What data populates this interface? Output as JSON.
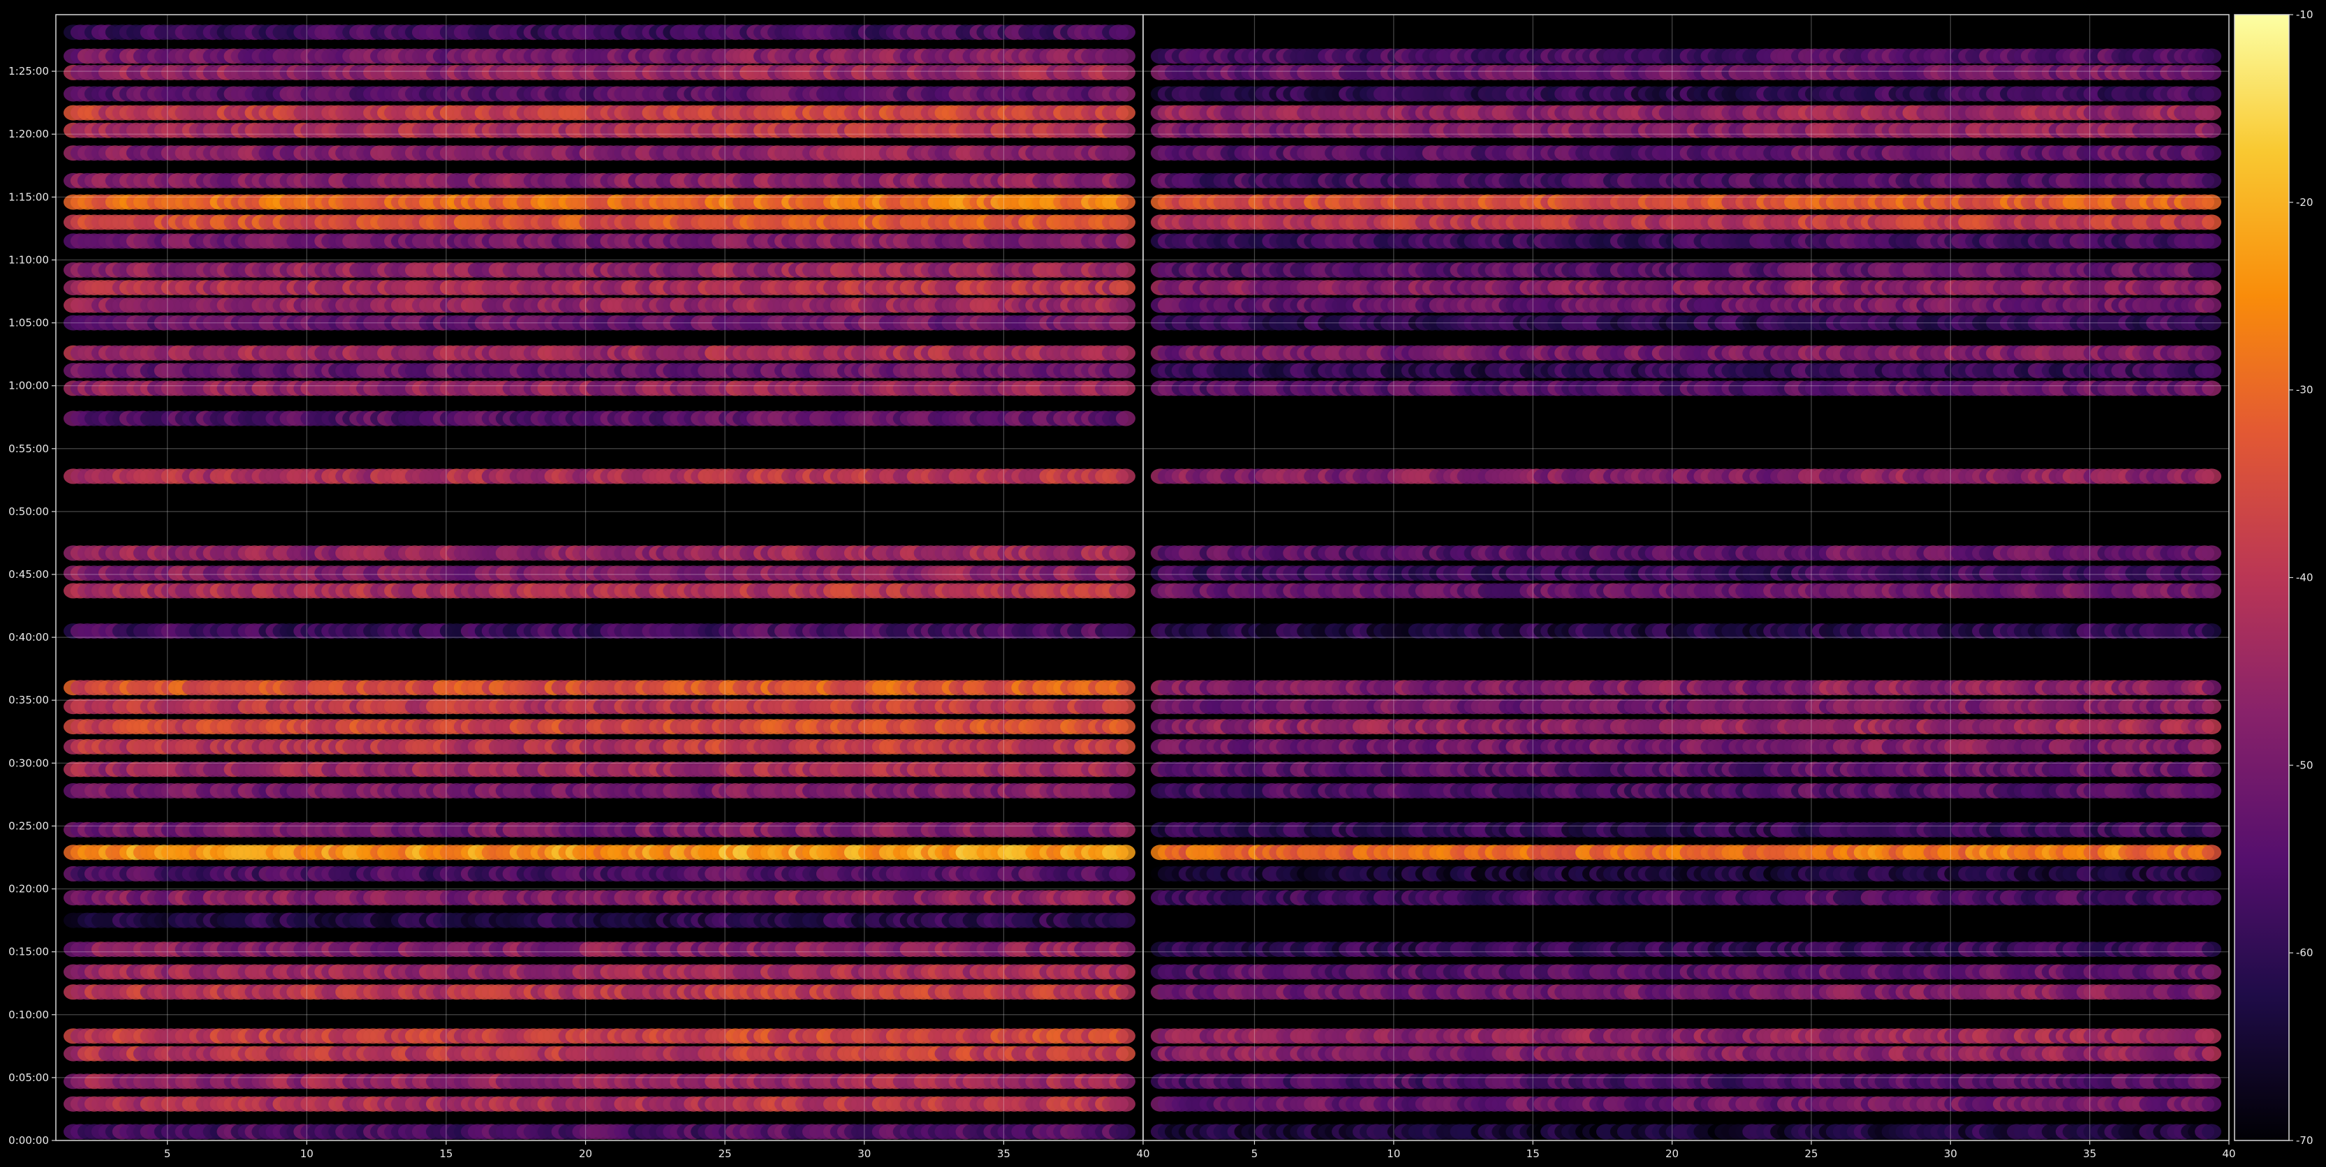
{
  "chart_data": {
    "type": "heatmap",
    "title": "",
    "xlabel": "",
    "ylabel": "",
    "background": "#000000",
    "colormap": "inferno",
    "grid": true,
    "panels": [
      {
        "name": "",
        "xlim": [
          1,
          40
        ],
        "xticks": [
          5,
          10,
          15,
          20,
          25,
          30,
          35,
          40
        ],
        "xtick_labels": [
          "5",
          "10",
          "15",
          "20",
          "25",
          "30",
          "35",
          "40"
        ],
        "channels": [
          2,
          39
        ]
      },
      {
        "name": "",
        "xlim": [
          1,
          40
        ],
        "xticks": [
          5,
          10,
          15,
          20,
          25,
          30,
          35,
          40
        ],
        "xtick_labels": [
          "5",
          "10",
          "15",
          "20",
          "25",
          "30",
          "35",
          "40"
        ],
        "channels": [
          2,
          39
        ]
      }
    ],
    "y_axis": {
      "unit": "minutes",
      "ylim": [
        0,
        89.5
      ],
      "ticks": [
        0,
        5,
        10,
        15,
        20,
        25,
        30,
        35,
        40,
        45,
        50,
        55,
        60,
        65,
        70,
        75,
        80,
        85
      ],
      "tick_labels": [
        "0:00:00",
        "0:05:00",
        "0:10:00",
        "0:15:00",
        "0:20:00",
        "0:25:00",
        "0:30:00",
        "0:35:00",
        "0:40:00",
        "0:45:00",
        "0:50:00",
        "0:55:00",
        "1:00:00",
        "1:05:00",
        "1:10:00",
        "1:15:00",
        "1:20:00",
        "1:25:00"
      ]
    },
    "colorbar": {
      "range": [
        -70,
        -10
      ],
      "ticks": [
        -70,
        -60,
        -50,
        -40,
        -30,
        -20,
        -10
      ],
      "tick_labels": [
        "-70",
        "-60",
        "-50",
        "-40",
        "-30",
        "-20",
        "-10"
      ]
    },
    "bands_left": [
      {
        "t": 0.7,
        "lvl": -56
      },
      {
        "t": 2.9,
        "lvl": -42
      },
      {
        "t": 4.7,
        "lvl": -45
      },
      {
        "t": 6.9,
        "lvl": -40
      },
      {
        "t": 8.3,
        "lvl": -38
      },
      {
        "t": 11.8,
        "lvl": -40
      },
      {
        "t": 13.4,
        "lvl": -44
      },
      {
        "t": 15.2,
        "lvl": -48
      },
      {
        "t": 17.5,
        "lvl": -62
      },
      {
        "t": 19.3,
        "lvl": -48
      },
      {
        "t": 21.2,
        "lvl": -56
      },
      {
        "t": 22.9,
        "lvl": -24
      },
      {
        "t": 24.7,
        "lvl": -50
      },
      {
        "t": 27.8,
        "lvl": -50
      },
      {
        "t": 29.5,
        "lvl": -44
      },
      {
        "t": 31.3,
        "lvl": -40
      },
      {
        "t": 32.9,
        "lvl": -36
      },
      {
        "t": 34.5,
        "lvl": -40
      },
      {
        "t": 36.0,
        "lvl": -34
      },
      {
        "t": 40.5,
        "lvl": -58
      },
      {
        "t": 43.7,
        "lvl": -42
      },
      {
        "t": 45.1,
        "lvl": -48
      },
      {
        "t": 46.7,
        "lvl": -46
      },
      {
        "t": 52.8,
        "lvl": -42
      },
      {
        "t": 57.4,
        "lvl": -54
      },
      {
        "t": 59.8,
        "lvl": -46
      },
      {
        "t": 61.2,
        "lvl": -52
      },
      {
        "t": 62.6,
        "lvl": -44
      },
      {
        "t": 65.0,
        "lvl": -52
      },
      {
        "t": 66.4,
        "lvl": -46
      },
      {
        "t": 67.8,
        "lvl": -42
      },
      {
        "t": 69.2,
        "lvl": -46
      },
      {
        "t": 71.5,
        "lvl": -50
      },
      {
        "t": 73.0,
        "lvl": -34
      },
      {
        "t": 74.6,
        "lvl": -30
      },
      {
        "t": 76.3,
        "lvl": -48
      },
      {
        "t": 78.5,
        "lvl": -48
      },
      {
        "t": 80.3,
        "lvl": -42
      },
      {
        "t": 81.7,
        "lvl": -38
      },
      {
        "t": 83.2,
        "lvl": -54
      },
      {
        "t": 84.9,
        "lvl": -46
      },
      {
        "t": 86.2,
        "lvl": -50
      },
      {
        "t": 88.1,
        "lvl": -58
      }
    ],
    "bands_right": [
      {
        "t": 0.7,
        "lvl": -64
      },
      {
        "t": 2.9,
        "lvl": -52
      },
      {
        "t": 4.7,
        "lvl": -56
      },
      {
        "t": 6.9,
        "lvl": -48
      },
      {
        "t": 8.3,
        "lvl": -46
      },
      {
        "t": 11.8,
        "lvl": -50
      },
      {
        "t": 13.4,
        "lvl": -54
      },
      {
        "t": 15.2,
        "lvl": -60
      },
      {
        "t": 19.3,
        "lvl": -58
      },
      {
        "t": 21.2,
        "lvl": -64
      },
      {
        "t": 22.9,
        "lvl": -30
      },
      {
        "t": 24.7,
        "lvl": -60
      },
      {
        "t": 27.8,
        "lvl": -56
      },
      {
        "t": 29.5,
        "lvl": -54
      },
      {
        "t": 31.3,
        "lvl": -50
      },
      {
        "t": 32.9,
        "lvl": -46
      },
      {
        "t": 34.5,
        "lvl": -50
      },
      {
        "t": 36.0,
        "lvl": -48
      },
      {
        "t": 40.5,
        "lvl": -62
      },
      {
        "t": 43.7,
        "lvl": -52
      },
      {
        "t": 45.1,
        "lvl": -58
      },
      {
        "t": 46.7,
        "lvl": -54
      },
      {
        "t": 52.8,
        "lvl": -48
      },
      {
        "t": 59.8,
        "lvl": -54
      },
      {
        "t": 61.2,
        "lvl": -60
      },
      {
        "t": 62.6,
        "lvl": -50
      },
      {
        "t": 65.0,
        "lvl": -60
      },
      {
        "t": 66.4,
        "lvl": -52
      },
      {
        "t": 67.8,
        "lvl": -48
      },
      {
        "t": 69.2,
        "lvl": -54
      },
      {
        "t": 71.5,
        "lvl": -58
      },
      {
        "t": 73.0,
        "lvl": -40
      },
      {
        "t": 74.6,
        "lvl": -34
      },
      {
        "t": 76.3,
        "lvl": -56
      },
      {
        "t": 78.5,
        "lvl": -54
      },
      {
        "t": 80.3,
        "lvl": -48
      },
      {
        "t": 81.7,
        "lvl": -46
      },
      {
        "t": 83.2,
        "lvl": -60
      },
      {
        "t": 84.9,
        "lvl": -52
      },
      {
        "t": 86.2,
        "lvl": -56
      }
    ]
  }
}
